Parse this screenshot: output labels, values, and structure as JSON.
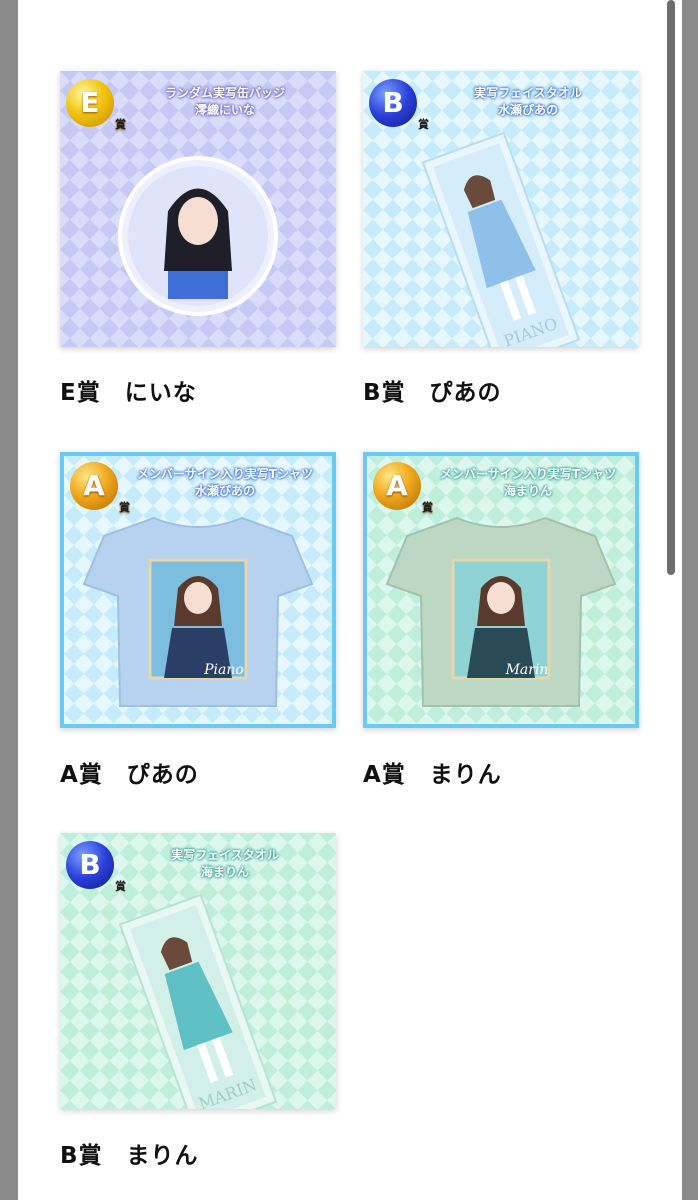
{
  "prizes": [
    {
      "badge_letter": "E",
      "badge_suffix": "賞",
      "product_line1": "ランダム実写缶バッジ",
      "product_line2": "澪織にいな",
      "caption": "E賞　にいな",
      "item_icon": "badge-icon",
      "theme_color": "#c3c8f5"
    },
    {
      "badge_letter": "B",
      "badge_suffix": "賞",
      "product_line1": "実写フェイスタオル",
      "product_line2": "水瀬ぴあの",
      "towel_text": "PIANO",
      "caption": "B賞　ぴあの",
      "item_icon": "towel-icon",
      "theme_color": "#cfeefc"
    },
    {
      "badge_letter": "A",
      "badge_suffix": "賞",
      "product_line1": "メンバーサイン入り実写Tシャツ",
      "product_line2": "水瀬ぴあの",
      "shirt_sign": "Piano",
      "caption": "A賞　ぴあの",
      "item_icon": "tshirt-icon",
      "theme_color": "#cfeefc"
    },
    {
      "badge_letter": "A",
      "badge_suffix": "賞",
      "product_line1": "メンバーサイン入り実写Tシャツ",
      "product_line2": "海まりん",
      "shirt_sign": "Marin",
      "caption": "A賞　まりん",
      "item_icon": "tshirt-icon",
      "theme_color": "#c7f0e4"
    },
    {
      "badge_letter": "B",
      "badge_suffix": "賞",
      "product_line1": "実写フェイスタオル",
      "product_line2": "海まりん",
      "towel_text": "MARIN",
      "caption": "B賞　まりん",
      "item_icon": "towel-icon",
      "theme_color": "#c7f0e4"
    }
  ]
}
